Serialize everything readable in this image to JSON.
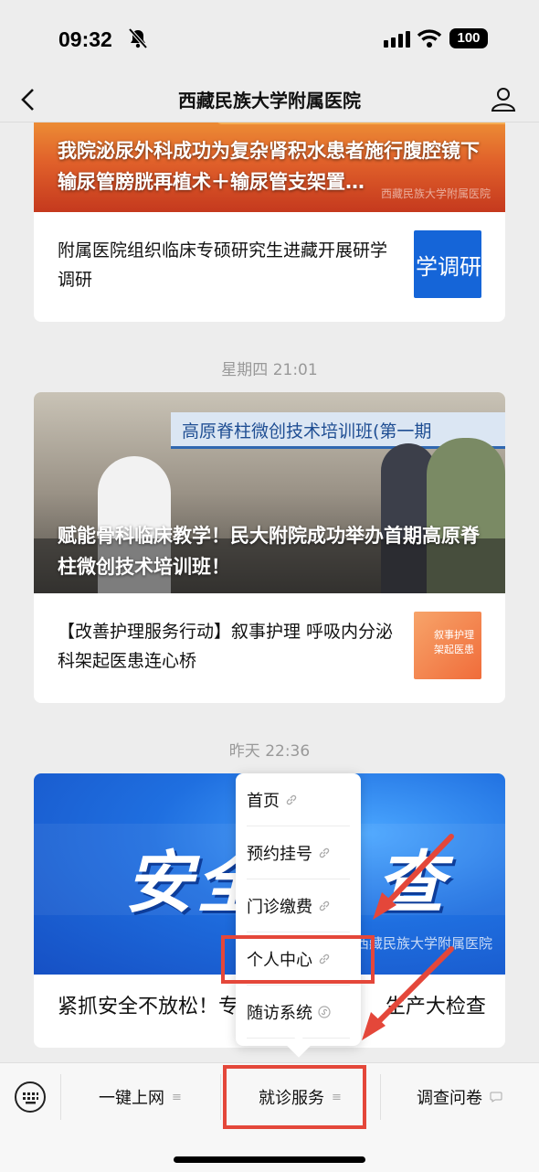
{
  "status_bar": {
    "time": "09:32",
    "battery": "100"
  },
  "nav": {
    "title": "西藏民族大学附属医院"
  },
  "feed": {
    "group1": {
      "hero_caption": "我院泌尿外科成功为复杂肾积水患者施行腹腔镜下输尿管膀胱再植术＋输尿管支架置…",
      "hero_watermark": "西藏民族大学附属医院",
      "row_text": "附属医院组织临床专硕研究生进藏开展研学调研",
      "row_thumb_text": "学调研"
    },
    "date2": "星期四 21:01",
    "group2": {
      "hero_banner": "高原脊柱微创技术培训班(第一期",
      "hero_caption": "赋能骨科临床教学！民大附院成功举办首期高原脊柱微创技术培训班！",
      "row_text": "【改善护理服务行动】叙事护理 呼吸内分泌科架起医患连心桥",
      "row_thumb_text": "叙事护理 架起医患"
    },
    "date3": "昨天 22:36",
    "group3": {
      "hero_big_text": "安全    查",
      "hero_watermark": "西藏民族大学附属医院",
      "row_text": "紧抓安全不放松！专                       生产大检查"
    }
  },
  "popup_menu": {
    "items": [
      {
        "label": "首页"
      },
      {
        "label": "预约挂号"
      },
      {
        "label": "门诊缴费"
      },
      {
        "label": "个人中心"
      },
      {
        "label": "随访系统"
      }
    ]
  },
  "bottom_menu": {
    "items": [
      {
        "label": "一键上网",
        "icon": "menu-lines-icon"
      },
      {
        "label": "就诊服务",
        "icon": "menu-lines-icon"
      },
      {
        "label": "调查问卷",
        "icon": "chat-bubble-icon"
      }
    ]
  },
  "colors": {
    "annotation_red": "#e4473a",
    "blue_banner": "#1f6fe0"
  }
}
